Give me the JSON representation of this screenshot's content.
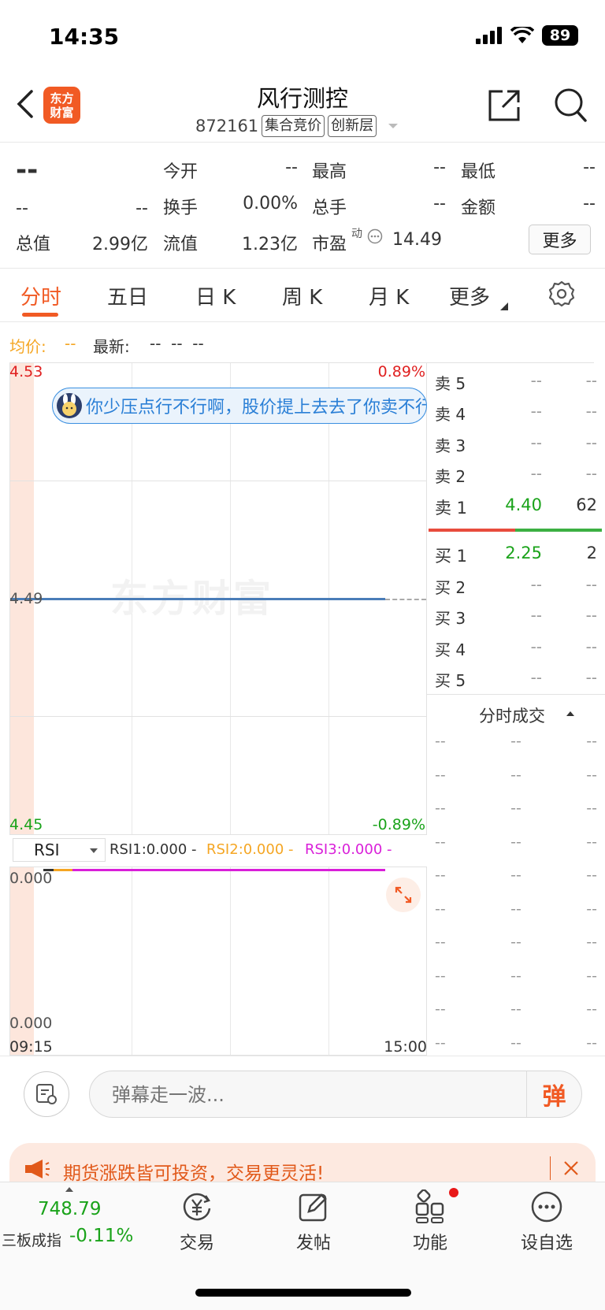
{
  "status": {
    "time": "14:35",
    "battery": "89"
  },
  "header": {
    "logo_line1": "东方",
    "logo_line2": "财富",
    "title": "风行测控",
    "code": "872161",
    "tag1": "集合竞价",
    "tag2": "创新层"
  },
  "quote": {
    "price": "--",
    "change": "--",
    "change_pct": "--",
    "labels": [
      "今开",
      "最高",
      "最低",
      "换手",
      "总手",
      "金额",
      "总值",
      "流值",
      "市盈"
    ],
    "open": "--",
    "high": "--",
    "low": "--",
    "turnover": "0.00%",
    "volume": "--",
    "amount": "--",
    "total_value": "2.99亿",
    "float_value": "1.23亿",
    "pe_sup": "动",
    "pe": "14.49",
    "more_label": "更多"
  },
  "tabs": [
    {
      "label": "分时",
      "active": true
    },
    {
      "label": "五日",
      "active": false
    },
    {
      "label": "日 K",
      "active": false
    },
    {
      "label": "周 K",
      "active": false
    },
    {
      "label": "月 K",
      "active": false
    },
    {
      "label": "更多",
      "active": false
    }
  ],
  "chart": {
    "avg_label": "均价:",
    "avg_value": "--",
    "latest_label": "最新:",
    "latest_values": "--  --  --",
    "y_top": "4.53",
    "y_mid": "4.49",
    "y_bot": "4.45",
    "pct_top": "0.89%",
    "pct_bot": "-0.89%",
    "danmu": "你少压点行不行啊，股价提上去去了你卖不行吗",
    "watermark": "东方财富",
    "time_start": "09:15",
    "time_end": "15:00",
    "colors": {
      "up": "#e02020",
      "down": "#1aa31a",
      "line": "#4a7db8",
      "avg": "#f5a623"
    }
  },
  "rsi": {
    "selector": "RSI",
    "rsi1": "RSI1:0.000 -",
    "rsi2": "RSI2:0.000 -",
    "rsi3": "RSI3:0.000 -",
    "y_top": "0.000",
    "y_bot": "0.000"
  },
  "orderbook": {
    "asks": [
      {
        "label": "卖 5",
        "price": "--",
        "vol": "--"
      },
      {
        "label": "卖 4",
        "price": "--",
        "vol": "--"
      },
      {
        "label": "卖 3",
        "price": "--",
        "vol": "--"
      },
      {
        "label": "卖 2",
        "price": "--",
        "vol": "--"
      },
      {
        "label": "卖 1",
        "price": "4.40",
        "vol": "62"
      }
    ],
    "bids": [
      {
        "label": "买 1",
        "price": "2.25",
        "vol": "2"
      },
      {
        "label": "买 2",
        "price": "--",
        "vol": "--"
      },
      {
        "label": "买 3",
        "price": "--",
        "vol": "--"
      },
      {
        "label": "买 4",
        "price": "--",
        "vol": "--"
      },
      {
        "label": "买 5",
        "price": "--",
        "vol": "--"
      }
    ],
    "trades_title": "分时成交",
    "trade_row": [
      "--",
      "--",
      "--"
    ]
  },
  "danmaku_input": {
    "placeholder": "弹幕走一波...",
    "send": "弹"
  },
  "promo": {
    "text": "期货涨跌皆可投资，交易更灵活!"
  },
  "nav": {
    "index_value": "748.79",
    "index_name": "三板成指",
    "index_change": "-0.11%",
    "items": [
      "交易",
      "发帖",
      "功能",
      "设自选"
    ]
  }
}
